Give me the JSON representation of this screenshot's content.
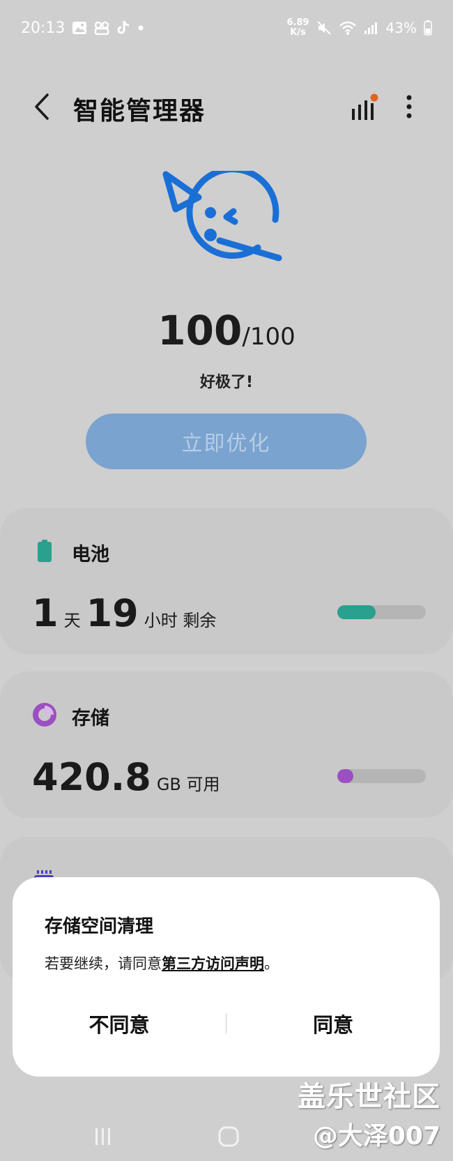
{
  "status_bar": {
    "time": "20:13",
    "net_speed_value": "6.89",
    "net_speed_unit": "K/s",
    "battery_percent": "43%",
    "left_icons": [
      "gallery-icon",
      "app-icon",
      "tiktok-icon",
      "dot-icon"
    ],
    "right_icons": [
      "mute-icon",
      "wifi-icon",
      "signal-icon",
      "battery-icon"
    ]
  },
  "header": {
    "title": "智能管理器"
  },
  "score": {
    "value": "100",
    "total": "/100",
    "status": "好极了!"
  },
  "optimize_button": {
    "label": "立即优化"
  },
  "battery_card": {
    "title": "电池",
    "days": "1",
    "days_unit": "天",
    "hours": "19",
    "hours_unit": "小时 剩余",
    "level_fraction": 0.43,
    "accent_color": "#2aa08f"
  },
  "storage_card": {
    "title": "存储",
    "value": "420.8",
    "unit": "GB 可用",
    "used_fraction": 0.18,
    "accent_color": "#9b4fc2"
  },
  "dialog": {
    "title": "存储空间清理",
    "body_prefix": "若要继续，请同意",
    "link_text": "第三方访问声明",
    "body_suffix": "。",
    "decline_label": "不同意",
    "accept_label": "同意"
  },
  "watermark": {
    "line1": "盖乐世社区",
    "line2": "@大泽007"
  },
  "colors": {
    "brand_blue": "#1a6fd6",
    "notification_dot": "#e0651e"
  }
}
